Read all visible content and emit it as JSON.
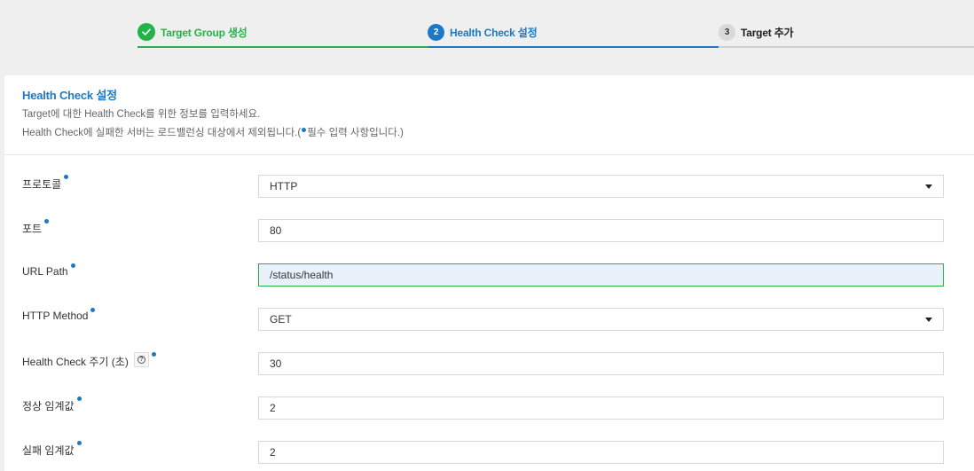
{
  "stepper": {
    "steps": [
      {
        "number": "",
        "label": "Target Group 생성",
        "state": "done"
      },
      {
        "number": "2",
        "label": "Health Check 설정",
        "state": "active"
      },
      {
        "number": "3",
        "label": "Target 추가",
        "state": "pending"
      }
    ]
  },
  "panel": {
    "title": "Health Check 설정",
    "description1": "Target에 대한 Health Check를 위한 정보를 입력하세요.",
    "description2_pre": "Health Check에 실패한 서버는 로드밸런싱 대상에서 제외됩니다.(",
    "description2_post": "필수 입력 사항입니다.)"
  },
  "form": {
    "protocol": {
      "label": "프로토콜",
      "value": "HTTP"
    },
    "port": {
      "label": "포트",
      "value": "80"
    },
    "url_path": {
      "label": "URL Path",
      "value": "/status/health"
    },
    "http_method": {
      "label": "HTTP Method",
      "value": "GET"
    },
    "interval": {
      "label": "Health Check 주기 (초)",
      "value": "30"
    },
    "healthy_threshold": {
      "label": "정상 임계값",
      "value": "2"
    },
    "unhealthy_threshold": {
      "label": "실패 임계값",
      "value": "2"
    }
  },
  "colors": {
    "done": "#22b44a",
    "active": "#1e78c8",
    "required_dot": "#1e78c8"
  }
}
